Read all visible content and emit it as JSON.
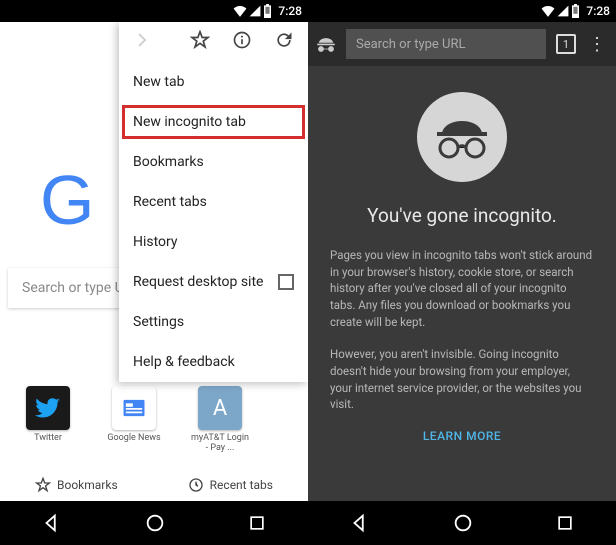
{
  "status": {
    "time": "7:28"
  },
  "left": {
    "search_placeholder": "Search or type U",
    "shortcuts": [
      {
        "label": "Twitter"
      },
      {
        "label": "Google News"
      },
      {
        "label": "myAT&T Login - Pay ..."
      }
    ],
    "bottom_bookmarks": "Bookmarks",
    "bottom_recent": "Recent tabs",
    "menu": {
      "new_tab": "New tab",
      "new_incognito": "New incognito tab",
      "bookmarks": "Bookmarks",
      "recent_tabs": "Recent tabs",
      "history": "History",
      "request_desktop": "Request desktop site",
      "settings": "Settings",
      "help": "Help & feedback"
    }
  },
  "right": {
    "url_placeholder": "Search or type URL",
    "tab_count": "1",
    "title": "You've gone incognito.",
    "para1": "Pages you view in incognito tabs won't stick around in your browser's history, cookie store, or search history after you've closed all of your incognito tabs. Any files you download or bookmarks you create will be kept.",
    "para2": "However, you aren't invisible. Going incognito doesn't hide your browsing from your employer, your internet service provider, or the websites you visit.",
    "learn_more": "LEARN MORE"
  }
}
